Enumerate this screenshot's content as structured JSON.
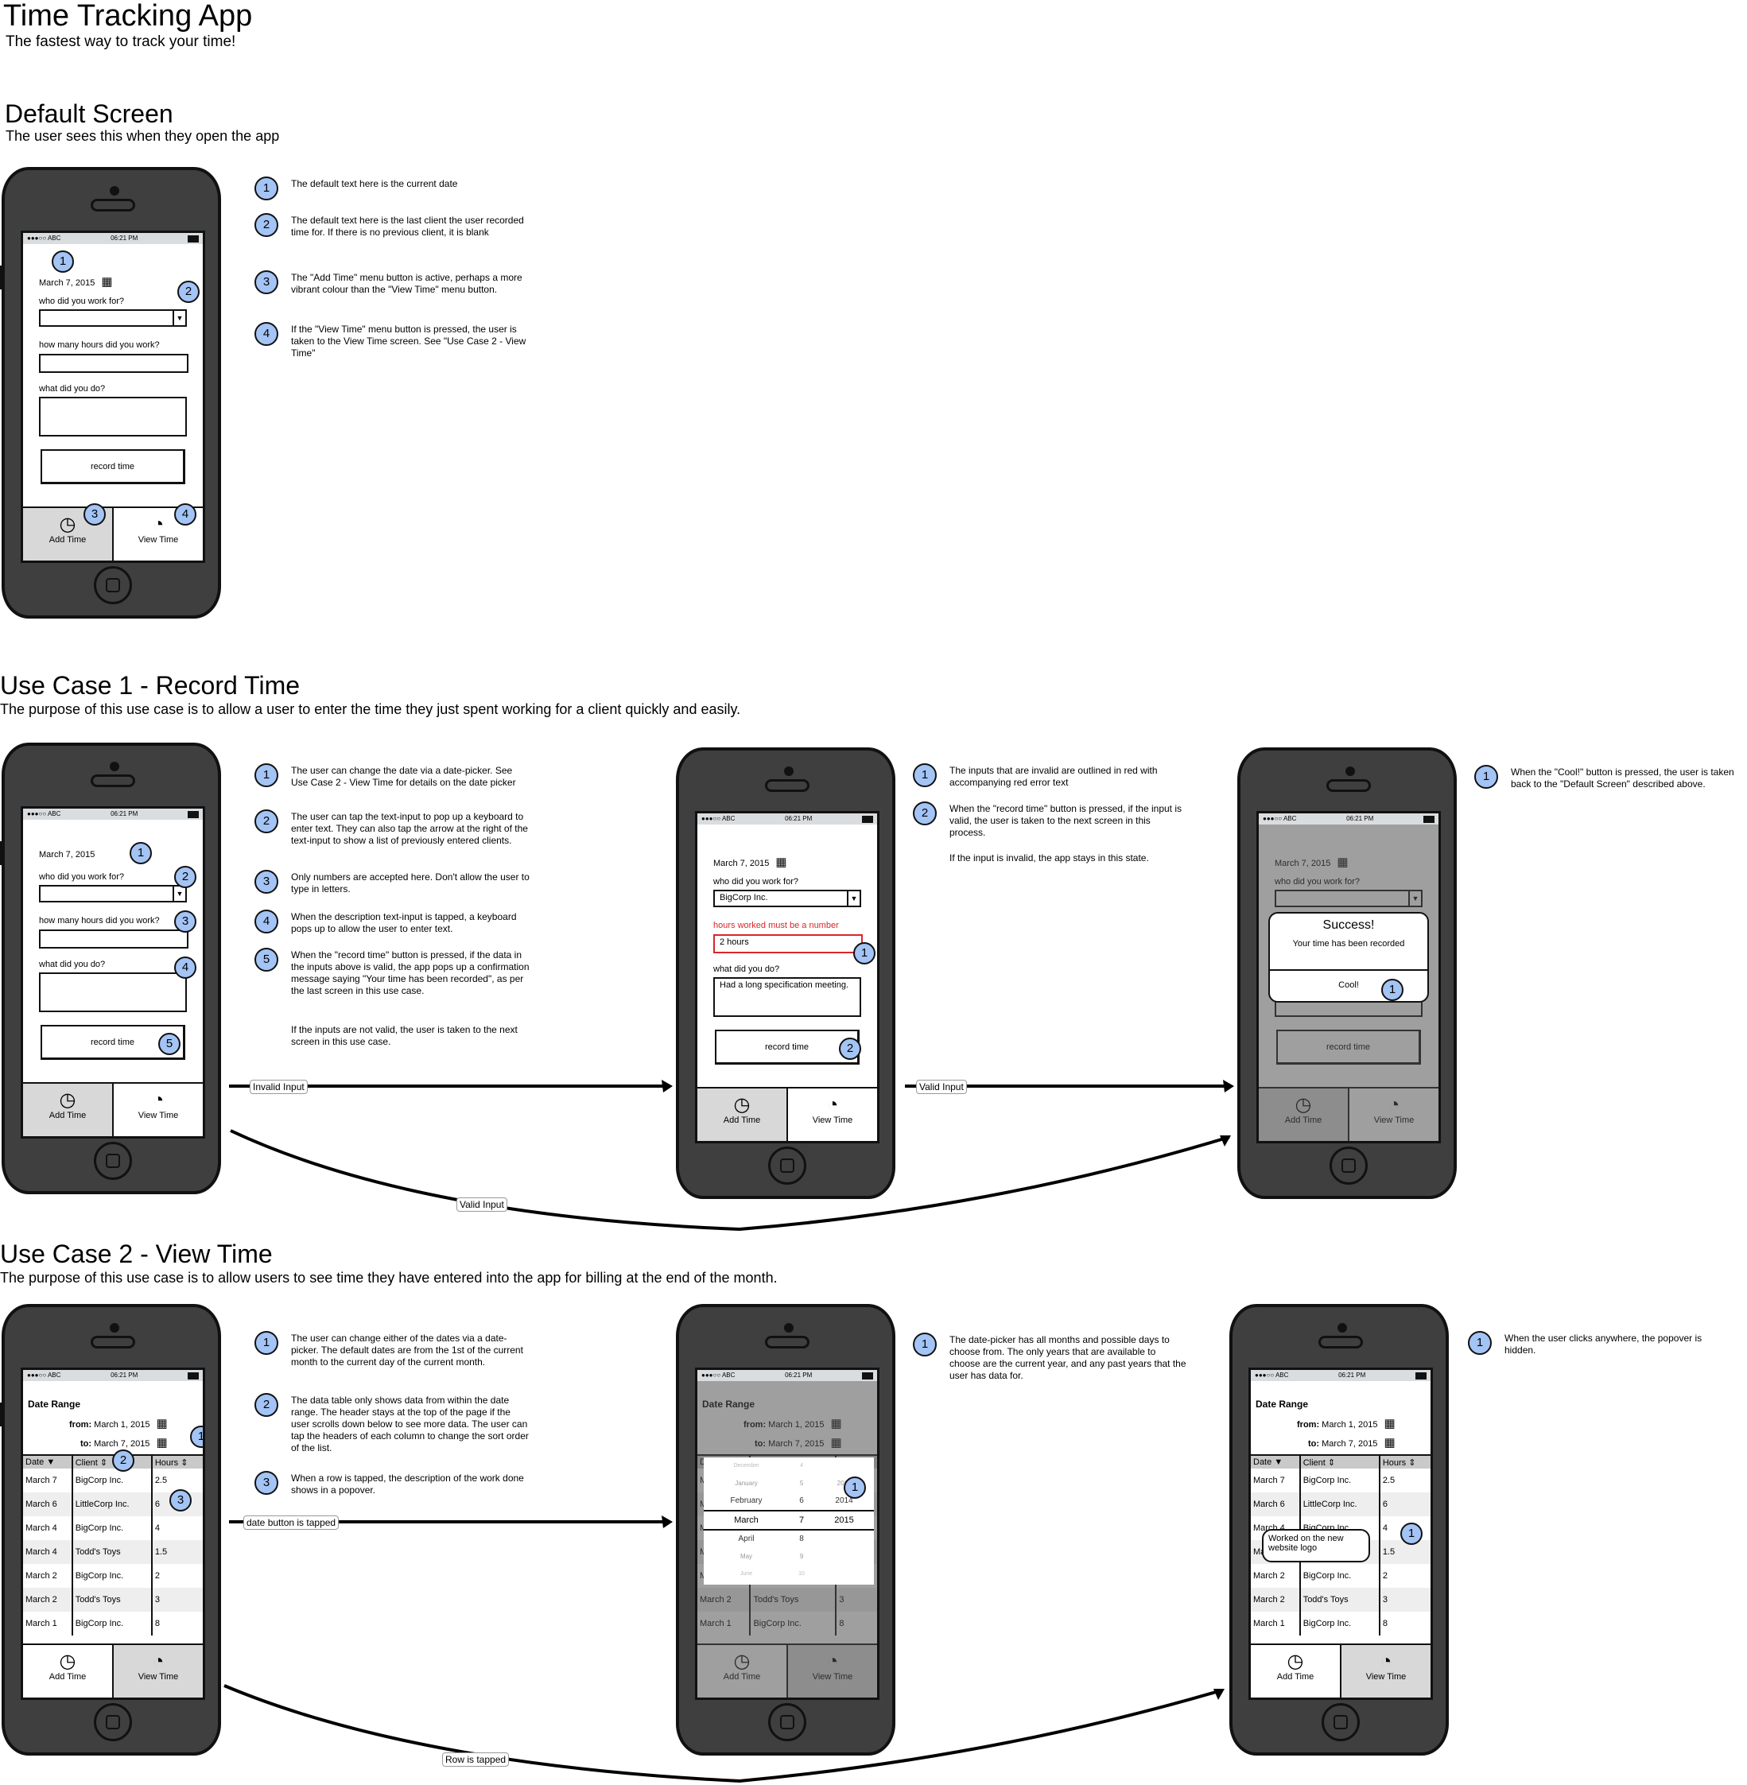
{
  "header": {
    "title": "Time Tracking App",
    "subtitle": "The fastest way to track your time!"
  },
  "phone_common": {
    "status_carrier": "●●●○○ ABC",
    "status_time": "06:21 PM",
    "tab_add": "Add Time",
    "tab_view": "View Time",
    "record_button": "record time",
    "q_client": "who did you work for?",
    "q_hours": "how many hours did you work?",
    "q_what": "what did you do?",
    "date": "March 7, 2015",
    "date_range_title": "Date Range",
    "from_label": "from:",
    "from_date": "March 1, 2015",
    "to_label": "to:",
    "to_date": "March 7, 2015",
    "col_date": "Date",
    "col_client": "Client",
    "col_hours": "Hours"
  },
  "default_screen": {
    "title": "Default Screen",
    "subtitle": "The user sees this when they open the app",
    "notes": [
      {
        "n": "1",
        "text": "The default text here is the current date"
      },
      {
        "n": "2",
        "text": "The default text here is the last client the user recorded time for.  If there is no previous client, it is blank"
      },
      {
        "n": "3",
        "text": "The \"Add Time\" menu button is active, perhaps a more vibrant colour than the \"View Time\" menu button."
      },
      {
        "n": "4",
        "text": "If the \"View Time\" menu button is pressed, the user is taken to the View Time screen.  See \"Use Case 2 - View Time\""
      }
    ]
  },
  "use_case_1": {
    "title": "Use Case 1 - Record Time",
    "subtitle": "The purpose of this use case is to allow a user to enter the time they just spent working for a client quickly and easily.",
    "notes_a": [
      {
        "n": "1",
        "text": "The user can change the date via a date-picker. See Use Case 2 - View Time for details on the date picker"
      },
      {
        "n": "2",
        "text": "The user can tap the text-input to pop up a keyboard to enter text.  They can also tap the arrow at the right of the text-input to show a list of previously entered clients."
      },
      {
        "n": "3",
        "text": "Only numbers are accepted here.  Don't allow the user to type in letters."
      },
      {
        "n": "4",
        "text": "When the description text-input is tapped, a keyboard pops up to allow the user to enter text."
      },
      {
        "n": "5",
        "text": "When the \"record time\" button is pressed, if the data in the inputs above is valid, the app pops up a confirmation message saying \"Your time has been recorded\", as per the last screen in this use case."
      }
    ],
    "notes_a_extra": "If the inputs are not valid, the user is taken to the next screen in this use case.",
    "notes_b": [
      {
        "n": "1",
        "text": "The inputs that are invalid are outlined in red with accompanying red error text"
      },
      {
        "n": "2",
        "text": "When the \"record time\" button is pressed, if the input is valid, the user is taken to the next screen in this process."
      }
    ],
    "notes_b_extra": "If the input is invalid, the app stays in this state.",
    "notes_c": [
      {
        "n": "1",
        "text": "When the \"Cool!\" button is pressed, the user is taken back to the \"Default Screen\" described above."
      }
    ],
    "invalid_screen": {
      "client_value": "BigCorp Inc.",
      "error_text": "hours worked must be a number",
      "hours_value": "2 hours",
      "what_value": "Had a long specification meeting."
    },
    "success_dialog": {
      "title": "Success!",
      "message": "Your time has been recorded",
      "button": "Cool!"
    },
    "arrows": {
      "invalid": "Invalid Input",
      "valid_top": "Valid Input",
      "valid_bottom": "Valid Input"
    }
  },
  "use_case_2": {
    "title": "Use Case 2 - View Time",
    "subtitle": "The purpose of this use case is to allow users to see time they have entered into the app for billing at the end of the month.",
    "notes_a": [
      {
        "n": "1",
        "text": "The user can change either of the dates via a date-picker.  The default dates are from the 1st of the current month to the current day of the current month."
      },
      {
        "n": "2",
        "text": "The data table only shows data from within the date range.  The header stays at the top of the page if the user scrolls down below to see more data.  The user can tap the headers of each column to change the sort order of the list."
      },
      {
        "n": "3",
        "text": "When a row is tapped, the description of the work done shows in a popover."
      }
    ],
    "notes_b": [
      {
        "n": "1",
        "text": "The date-picker has all months and possible days to choose from.  The only years that are available to choose are the current year, and any past years that the user has data for."
      }
    ],
    "notes_c": [
      {
        "n": "1",
        "text": "When the user clicks anywhere, the popover is hidden."
      }
    ],
    "rows": [
      {
        "date": "March 7",
        "client": "BigCorp Inc.",
        "hours": "2.5"
      },
      {
        "date": "March 6",
        "client": "LittleCorp Inc.",
        "hours": "6"
      },
      {
        "date": "March 4",
        "client": "BigCorp Inc.",
        "hours": "4"
      },
      {
        "date": "March 4",
        "client": "Todd's Toys",
        "hours": "1.5"
      },
      {
        "date": "March 2",
        "client": "BigCorp Inc.",
        "hours": "2"
      },
      {
        "date": "March 2",
        "client": "Todd's Toys",
        "hours": "3"
      },
      {
        "date": "March 1",
        "client": "BigCorp Inc.",
        "hours": "8"
      }
    ],
    "picker": {
      "months": [
        "December",
        "January",
        "February",
        "March",
        "April",
        "May",
        "June"
      ],
      "days": [
        "4",
        "5",
        "6",
        "7",
        "8",
        "9",
        "10"
      ],
      "years": [
        "",
        "2013",
        "2014",
        "2015",
        "",
        "",
        ""
      ]
    },
    "popover_text": "Worked on the new website logo",
    "arrows": {
      "date_tapped": "date button is tapped",
      "row_tapped": "Row is tapped"
    }
  }
}
